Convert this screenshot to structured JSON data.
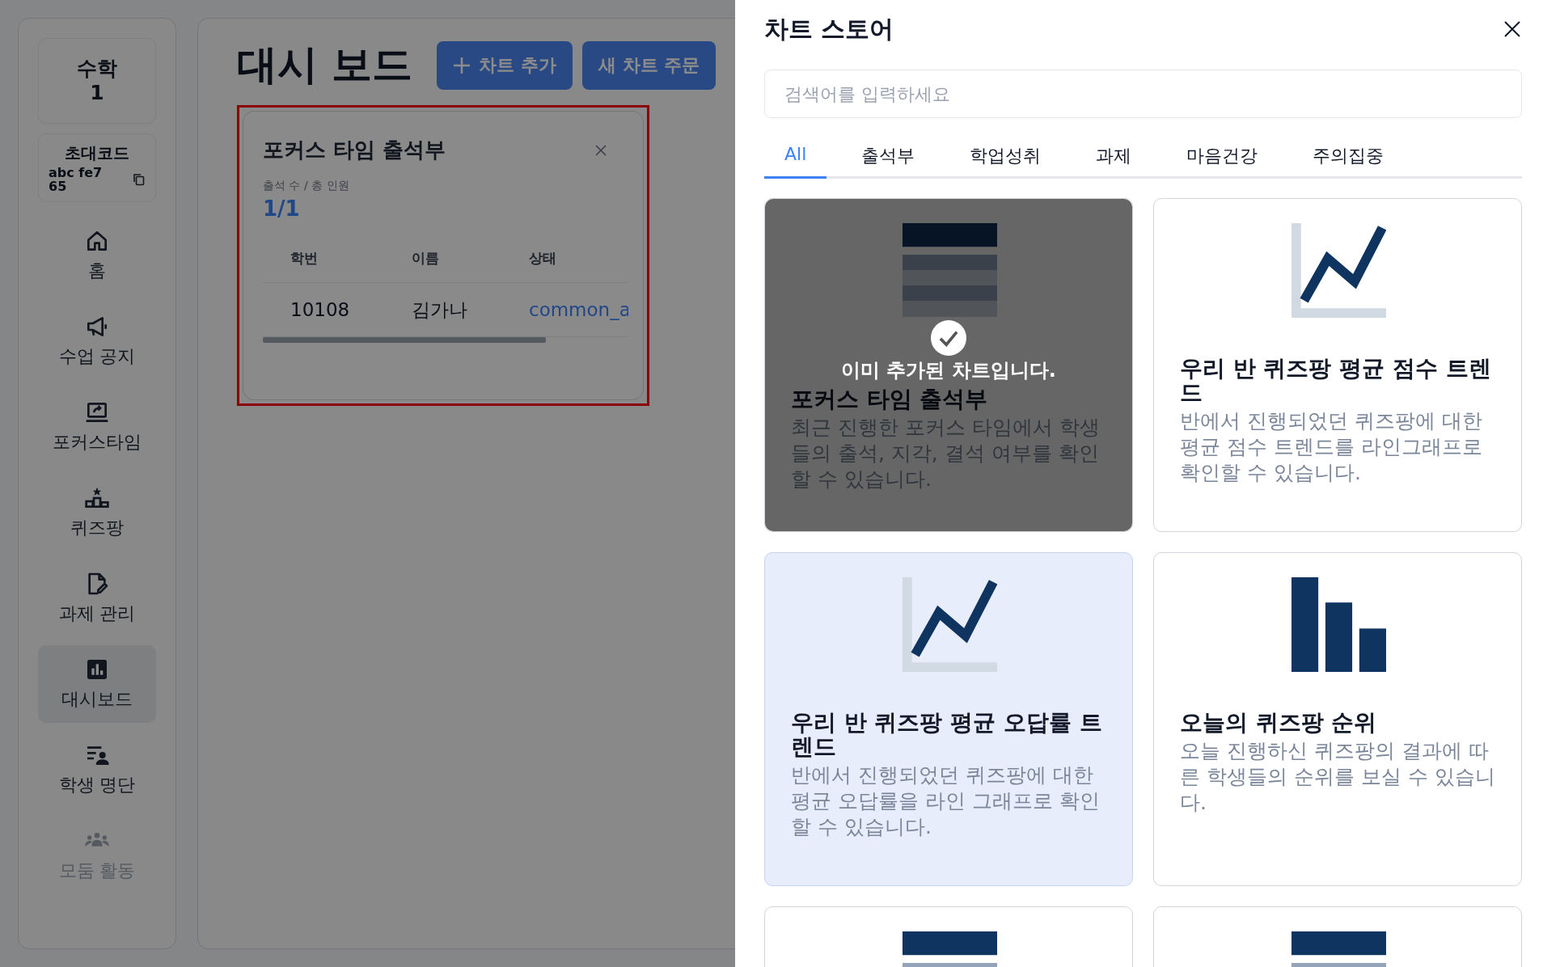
{
  "sidebar": {
    "class_card": {
      "subject": "수학",
      "number": "1"
    },
    "invite": {
      "label": "초대코드",
      "code": "abc fe765"
    },
    "nav": [
      {
        "label": "홈",
        "selected": false,
        "disabled": false
      },
      {
        "label": "수업 공지",
        "selected": false,
        "disabled": false
      },
      {
        "label": "포커스타임",
        "selected": false,
        "disabled": false
      },
      {
        "label": "퀴즈팡",
        "selected": false,
        "disabled": false
      },
      {
        "label": "과제 관리",
        "selected": false,
        "disabled": false
      },
      {
        "label": "대시보드",
        "selected": true,
        "disabled": false
      },
      {
        "label": "학생 명단",
        "selected": false,
        "disabled": false
      },
      {
        "label": "모둠 활동",
        "selected": false,
        "disabled": true
      }
    ]
  },
  "dashboard": {
    "title": "대시 보드",
    "buttons": [
      {
        "label": "차트 추가",
        "kind": "add"
      },
      {
        "label": "새 차트 주문",
        "kind": "plain"
      }
    ],
    "widgets": [
      {
        "title": "포커스 타임 출석부",
        "highlighted": true,
        "stat_label": "출석 수 / 총 인원",
        "stat_value": "1/1",
        "table": {
          "columns": [
            "학번",
            "이름",
            "상태"
          ],
          "rows": [
            [
              "10108",
              "김가나",
              "common_a"
            ]
          ]
        }
      }
    ]
  },
  "chart_store": {
    "title": "차트 스토어",
    "search": {
      "placeholder": "검색어를 입력하세요"
    },
    "tabs": [
      {
        "label": "All",
        "selected": true
      },
      {
        "label": "출석부",
        "selected": false
      },
      {
        "label": "학업성취",
        "selected": false
      },
      {
        "label": "과제",
        "selected": false
      },
      {
        "label": "마음건강",
        "selected": false
      },
      {
        "label": "주의집중",
        "selected": false
      }
    ],
    "cards": [
      {
        "kind": "table",
        "title": "포커스 타임 출석부",
        "description": "최근 진행한 포커스 타임에서 학생들의 출석, 지각, 결석 여부를 확인할 수 있습니다.",
        "added": true,
        "added_note": "이미 추가된 차트입니다.",
        "selected": false
      },
      {
        "kind": "line",
        "title": "우리 반 퀴즈팡 평균 점수 트렌드",
        "description": "반에서 진행되었던 퀴즈팡에 대한 평균 점수 트렌드를 라인그래프로 확인할 수 있습니다.",
        "added": false,
        "selected": false
      },
      {
        "kind": "line",
        "title": "우리 반 퀴즈팡 평균 오답률 트렌드",
        "description": "반에서 진행되었던 퀴즈팡에 대한 평균 오답률을 라인 그래프로 확인할 수 있습니다.",
        "added": false,
        "selected": true
      },
      {
        "kind": "bar",
        "title": "오늘의 퀴즈팡 순위",
        "description": "오늘 진행하신 퀴즈팡의 결과에 따른 학생들의 순위를 보실 수 있습니다.",
        "added": false,
        "selected": false
      },
      {
        "kind": "table",
        "added": false,
        "selected": false
      },
      {
        "kind": "table",
        "added": false,
        "selected": false
      }
    ]
  }
}
